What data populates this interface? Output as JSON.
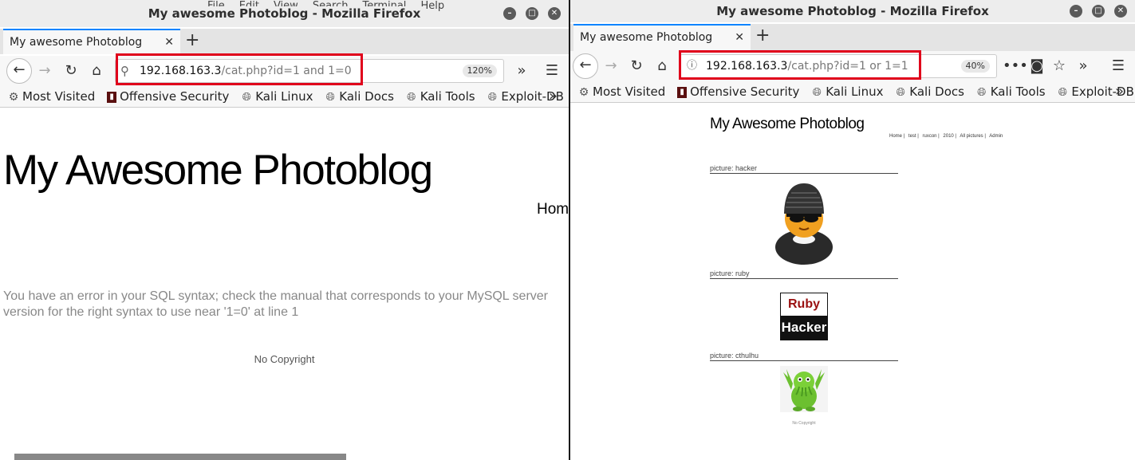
{
  "left": {
    "window_title": "My awesome Photoblog - Mozilla Firefox",
    "background_menu": [
      "File",
      "Edit",
      "View",
      "Search",
      "Terminal",
      "Help"
    ],
    "tab_title": "My awesome Photoblog",
    "url_host": "192.168.163.3",
    "url_path": "/cat.php?id=1 and 1=0",
    "zoom": "120%",
    "page_title": "My Awesome Photoblog",
    "nav_partial": "Hom",
    "error_text": "You have an error in your SQL syntax; check the manual that corresponds to your MySQL server version for the right syntax to use near '1=0' at line 1",
    "footer": "No Copyright"
  },
  "right": {
    "window_title": "My awesome Photoblog - Mozilla Firefox",
    "tab_title": "My awesome Photoblog",
    "url_host": "192.168.163.3",
    "url_path": "/cat.php?id=1 or 1=1",
    "zoom": "40%",
    "page_title": "My Awesome Photoblog",
    "nav": [
      "Home |",
      "test |",
      "ruxcon |",
      "2010 |",
      "All pictures |",
      "Admin"
    ],
    "pictures": [
      {
        "label": "picture: hacker"
      },
      {
        "label": "picture: ruby",
        "logo_line1": "Ruby",
        "logo_line2": "Hacker"
      },
      {
        "label": "picture: cthulhu"
      }
    ],
    "footer": "No Copyright"
  },
  "bookmarks": [
    "Most Visited",
    "Offensive Security",
    "Kali Linux",
    "Kali Docs",
    "Kali Tools",
    "Exploit-DB"
  ],
  "accent_color": "#0a84ff",
  "highlight_color": "#e0001b"
}
